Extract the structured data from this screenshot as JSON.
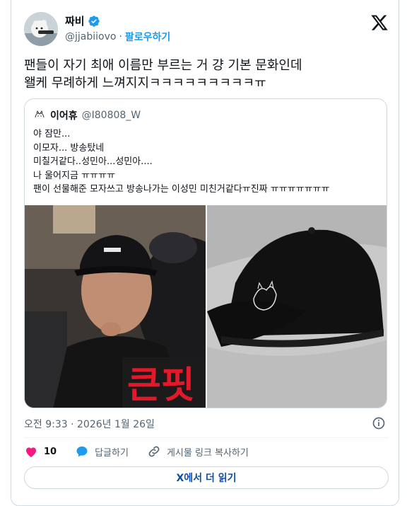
{
  "author": {
    "name": "짜비",
    "handle": "@jjabiiovo",
    "separator": "·",
    "follow_label": "팔로우하기"
  },
  "tweet": {
    "lines": [
      "팬들이 자기 최애 이름만 부르는 거 걍 기본 문화인데",
      "왤케 무례하게 느껴지지ㅋㅋㅋㅋㅋㅋㅋㅋㅋㅠ"
    ]
  },
  "quoted": {
    "name": "이어휴",
    "handle": "@I80808_W",
    "lines": [
      "야 잠만...",
      "이모자... 방송탔네",
      "미칠거같다..성민아...성민아....",
      "나 울어지금 ㅠㅠㅠㅠ",
      "팬이 선물해준 모자쓰고 방송나가는 이성민 미친거같다ㅠ진짜 ㅠㅠㅠㅠㅠㅠㅠ"
    ],
    "image_overlay_text": "큰핏"
  },
  "timestamp": "오전 9:33 · 2026년 1월 26일",
  "actions": {
    "like_count": "10",
    "reply_label": "답글하기",
    "copy_link_label": "게시물 링크 복사하기"
  },
  "read_more_label": "X에서 더 읽기",
  "colors": {
    "accent": "#1d9bf0",
    "like": "#f91880",
    "overlay_red": "#e1192b"
  },
  "icons": [
    "verified-badge-icon",
    "x-logo-icon",
    "info-icon",
    "heart-icon",
    "reply-icon",
    "link-icon"
  ]
}
